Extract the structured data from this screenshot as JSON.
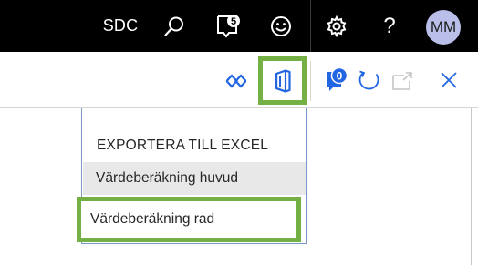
{
  "topbar": {
    "company": "SDC",
    "notes_count": "5",
    "user_initials": "MM",
    "icons": [
      "search-icon",
      "notes-icon",
      "feedback-smiley-icon",
      "settings-gear-icon",
      "help-icon"
    ]
  },
  "actionbar": {
    "icons": [
      "diamond-link-icon",
      "office-icon",
      "notification-badge-icon",
      "refresh-icon",
      "popout-icon",
      "close-icon"
    ],
    "badge_count": "0",
    "highlight_color": "#74b043"
  },
  "dropdown": {
    "header": "EXPORTERA TILL EXCEL",
    "items": [
      {
        "label": "Värdeberäkning huvud"
      },
      {
        "label": "Värdeberäkning rad"
      }
    ]
  },
  "colors": {
    "topbar_bg": "#000000",
    "accent_blue": "#2266e3",
    "highlight_green": "#74b043",
    "avatar_bg": "#b9bfe8"
  }
}
